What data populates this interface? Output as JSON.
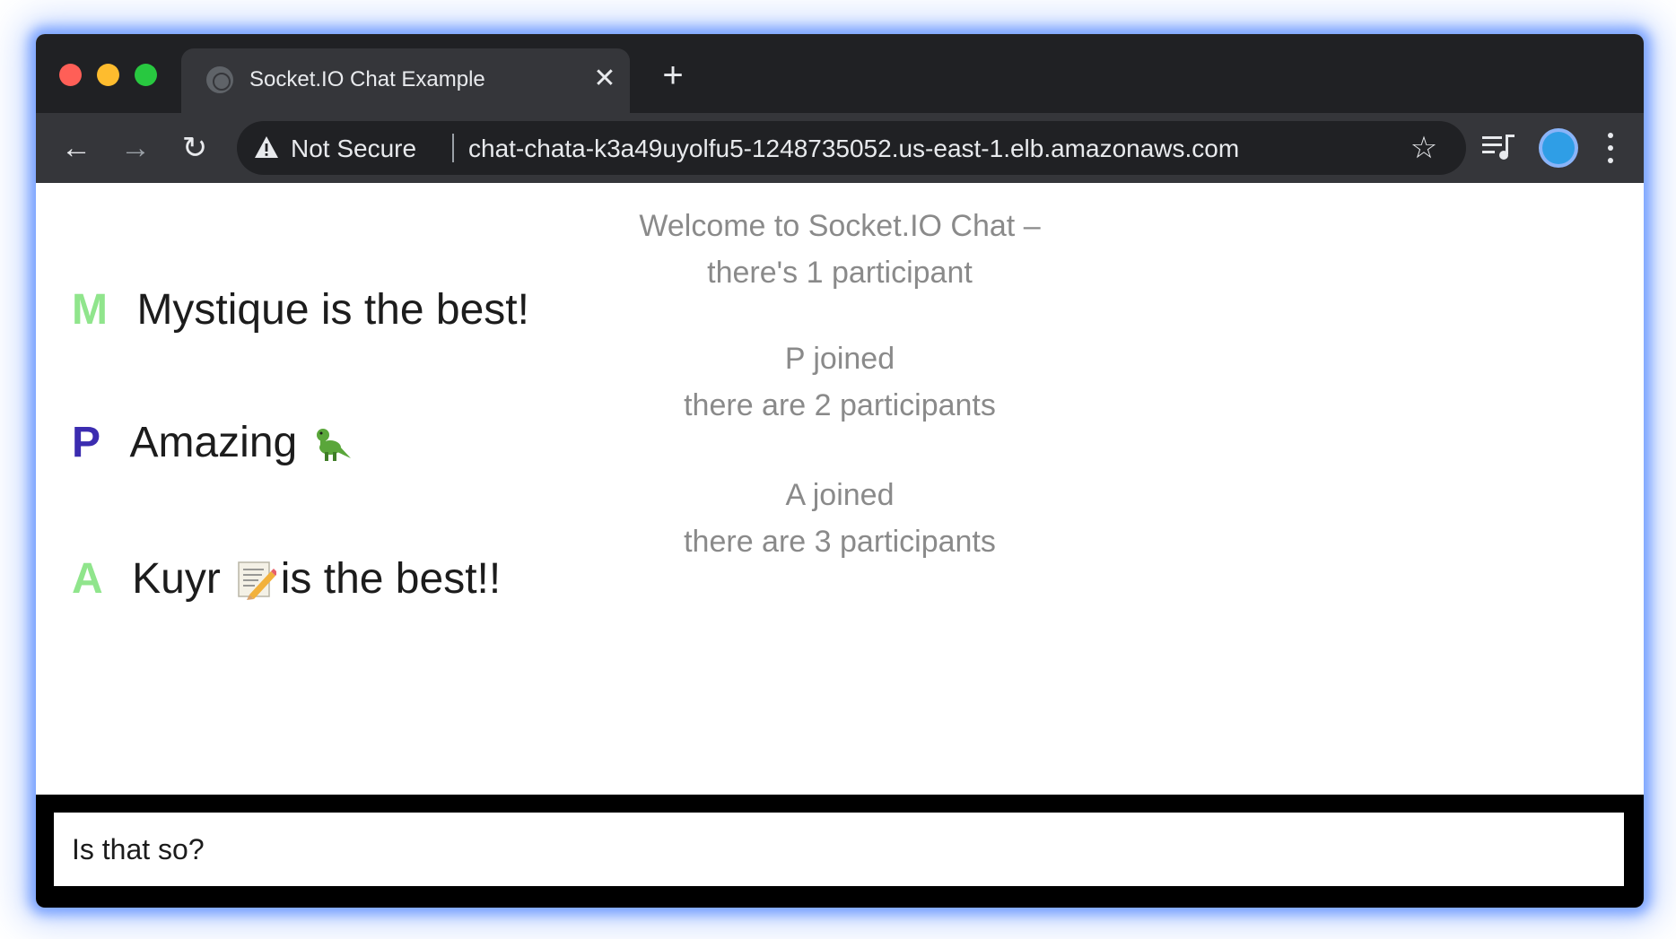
{
  "browser": {
    "tab": {
      "title": "Socket.IO Chat Example",
      "close_glyph": "✕",
      "favicon": "globe-icon"
    },
    "new_tab_glyph": "+",
    "toolbar": {
      "back_glyph": "←",
      "forward_glyph": "→",
      "reload_glyph": "↻",
      "security_label": "Not Secure",
      "url": "chat-chata-k3a49uyolfu5-1248735052.us-east-1.elb.amazonaws.com",
      "bookmark_glyph": "☆"
    },
    "colors": {
      "frame": "#202124",
      "toolbar": "#35363a",
      "text": "#e8eaed"
    }
  },
  "chat": {
    "system_messages": [
      {
        "line1": "Welcome to Socket.IO Chat –",
        "line2": "there's 1 participant"
      },
      {
        "line1": "P joined",
        "line2": "there are 2 participants"
      },
      {
        "line1": "A joined",
        "line2": "there are 3 participants"
      }
    ],
    "messages": [
      {
        "initial": "M",
        "initial_color": "#90e58c",
        "text": "Mystique is the best!",
        "emoji": ""
      },
      {
        "initial": "P",
        "initial_color": "#3b2cb0",
        "text": "Amazing",
        "emoji": "dinosaur"
      },
      {
        "initial": "A",
        "initial_color": "#90e58c",
        "text": "Kuyr",
        "emoji": "memo",
        "text_after": "is the best!!"
      }
    ]
  },
  "composer": {
    "value": "Is that so?"
  }
}
